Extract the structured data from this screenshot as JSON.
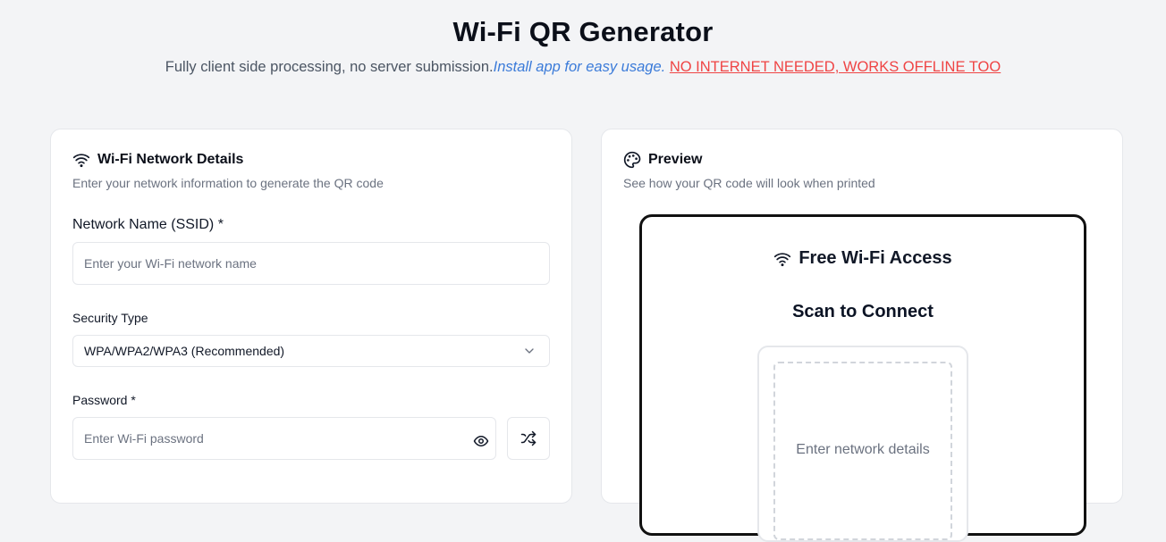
{
  "header": {
    "title": "Wi-Fi QR Generator",
    "subtitle": "Fully client side processing, no server submission.",
    "install_link": "Install app for easy usage.",
    "offline_note": "NO INTERNET NEEDED, WORKS OFFLINE TOO"
  },
  "form_card": {
    "icon": "wifi-icon",
    "title": "Wi-Fi Network Details",
    "description": "Enter your network information to generate the QR code",
    "ssid_label": "Network Name (SSID) *",
    "ssid_placeholder": "Enter your Wi-Fi network name",
    "ssid_value": "",
    "security_label": "Security Type",
    "security_value": "WPA/WPA2/WPA3 (Recommended)",
    "password_label": "Password *",
    "password_placeholder": "Enter Wi-Fi password",
    "password_value": ""
  },
  "preview_card": {
    "icon": "palette-icon",
    "title": "Preview",
    "description": "See how your QR code will look when printed",
    "print_title": "Free Wi-Fi Access",
    "print_subtitle": "Scan to Connect",
    "qr_placeholder": "Enter network details"
  },
  "colors": {
    "accent_link": "#3b7bd9",
    "warning": "#ef4444",
    "background": "#f3f4f6"
  }
}
